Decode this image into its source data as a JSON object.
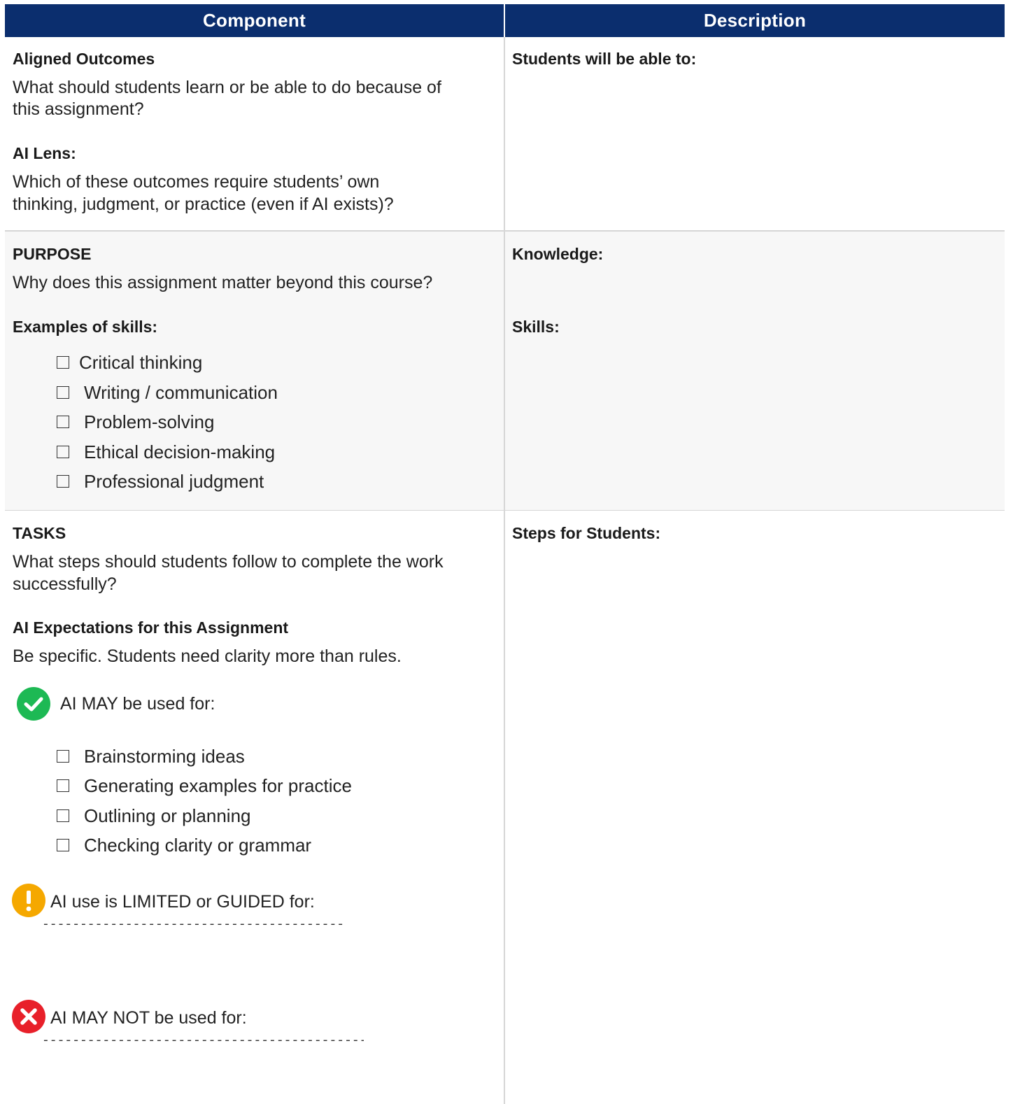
{
  "header": {
    "component": "Component",
    "description": "Description"
  },
  "outcomes": {
    "title": "Aligned Outcomes",
    "question_line1": "What should students learn or be able to do because of",
    "question_line2": "this assignment?",
    "lens_title": "AI Lens:",
    "lens_line1": "Which of these outcomes require students’ own",
    "lens_line2": "thinking, judgment, or practice (even if AI exists)?",
    "desc_label": "Students will be able to:"
  },
  "purpose": {
    "title": "PURPOSE",
    "question": "Why does this assignment matter beyond this course?",
    "skills_title": "Examples of skills:",
    "skills": [
      "Critical thinking",
      "Writing / communication",
      "Problem-solving",
      "Ethical decision-making",
      "Professional judgment"
    ],
    "knowledge_label": "Knowledge:",
    "skills_label": "Skills:"
  },
  "tasks": {
    "title": "TASKS",
    "question_line1": "What steps should students follow to complete the work",
    "question_line2": "successfully?",
    "ai_title": "AI Expectations for this Assignment",
    "ai_subtitle": "Be specific. Students need clarity more than rules.",
    "may_label": "AI MAY be used for:",
    "may_items": [
      "Brainstorming ideas",
      "Generating examples for practice",
      "Outlining or planning",
      "Checking clarity or grammar"
    ],
    "limited_label": "AI use is LIMITED or GUIDED for:",
    "limited_line": "----------------------------------------------",
    "not_label": "AI MAY NOT be used for:",
    "not_line": "-------------------------------------------------",
    "steps_label": "Steps for Students:"
  },
  "colors": {
    "header_bg": "#0b2e6e",
    "check_green": "#1db954",
    "warn_orange": "#f5a800",
    "no_red": "#e8202a"
  },
  "icons": {
    "may": "check-circle-icon",
    "limited": "exclamation-circle-icon",
    "not": "x-circle-icon"
  }
}
